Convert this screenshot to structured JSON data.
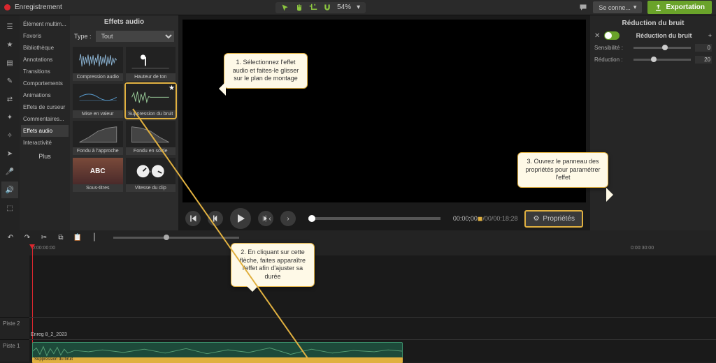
{
  "topbar": {
    "record": "Enregistrement",
    "zoom": "54%",
    "connect": "Se conne...",
    "export": "Exportation"
  },
  "sidebar": {
    "items": [
      "Élément multim...",
      "Favoris",
      "Bibliothèque",
      "Annotations",
      "Transitions",
      "Comportements",
      "Animations",
      "Effets de curseur",
      "Commentaires...",
      "Effets audio",
      "Interactivité"
    ],
    "plus": "Plus"
  },
  "effects": {
    "title": "Effets audio",
    "type_label": "Type :",
    "type_value": "Tout",
    "cards": [
      "Compression audio",
      "Hauteur de ton",
      "Mise en valeur",
      "Suppression du bruit",
      "Fondu à l'approche",
      "Fondu en sortie",
      "Sous-titres",
      "Vitesse du clip"
    ]
  },
  "playback": {
    "time_current": "00:00;00",
    "time_total": "00/00:18;28"
  },
  "props_panel": {
    "title": "Réduction du bruit",
    "row_label": "Réduction du bruit",
    "sensitivity_label": "Sensibilité :",
    "sensitivity_value": "0",
    "reduction_label": "Réduction :",
    "reduction_value": "20",
    "button": "Propriétés"
  },
  "timeline": {
    "ruler": [
      "0:00:00:00",
      "0:00:30:00"
    ],
    "tracks": [
      "Piste 2",
      "Piste 1"
    ],
    "clip_name": "Enreg 8_2_2023",
    "effect_strip": "Suppression du bruit"
  },
  "callouts": {
    "c1": "1. Sélectionnez l'effet audio et faites-le glisser sur le plan de montage",
    "c2": "2. En cliquant sur cette flèche, faites apparaître l'effet afin d'ajuster sa durée",
    "c3": "3. Ouvrez le panneau des propriétés pour paramétrer l'effet"
  }
}
